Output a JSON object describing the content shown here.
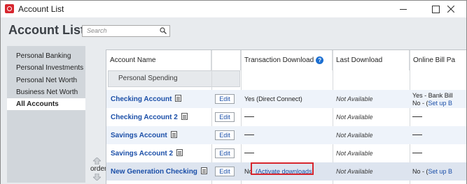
{
  "window": {
    "title": "Account List",
    "brand_color": "#d7262e"
  },
  "header": {
    "title": "Account List",
    "search_placeholder": "Search"
  },
  "sidebar": {
    "items": [
      {
        "label": "Personal Banking"
      },
      {
        "label": "Personal Investments"
      },
      {
        "label": "Personal Net Worth"
      },
      {
        "label": "Business Net Worth"
      },
      {
        "label": "All Accounts",
        "active": true
      }
    ]
  },
  "order_label": "order",
  "table": {
    "columns": [
      "Account Name",
      "",
      "Transaction Download",
      "Last Download",
      "Online Bill Pa"
    ],
    "group": "Personal Spending",
    "edit_label": "Edit",
    "rows": [
      {
        "name": "Checking Account",
        "download": "Yes (Direct Connect)",
        "last": "Not Available",
        "bill_line1": "Yes - Bank Bill",
        "bill_line2_prefix": "No - (",
        "bill_line2_link": "Set up B"
      },
      {
        "name": "Checking Account 2",
        "download": "",
        "last": "Not Available",
        "bill_line1": "",
        "bill_line2_prefix": "",
        "bill_line2_link": ""
      },
      {
        "name": "Savings Account",
        "download": "",
        "last": "Not Available",
        "bill_line1": "",
        "bill_line2_prefix": "",
        "bill_line2_link": ""
      },
      {
        "name": "Savings Account 2",
        "download": "",
        "last": "Not Available",
        "bill_line1": "",
        "bill_line2_prefix": "",
        "bill_line2_link": ""
      },
      {
        "name": "New Generation Checking",
        "download_prefix": "No",
        "download_link": "(Activate downloads)",
        "last": "Not Available",
        "bill_line1": "No - (",
        "bill_link": "Set up B"
      }
    ]
  }
}
